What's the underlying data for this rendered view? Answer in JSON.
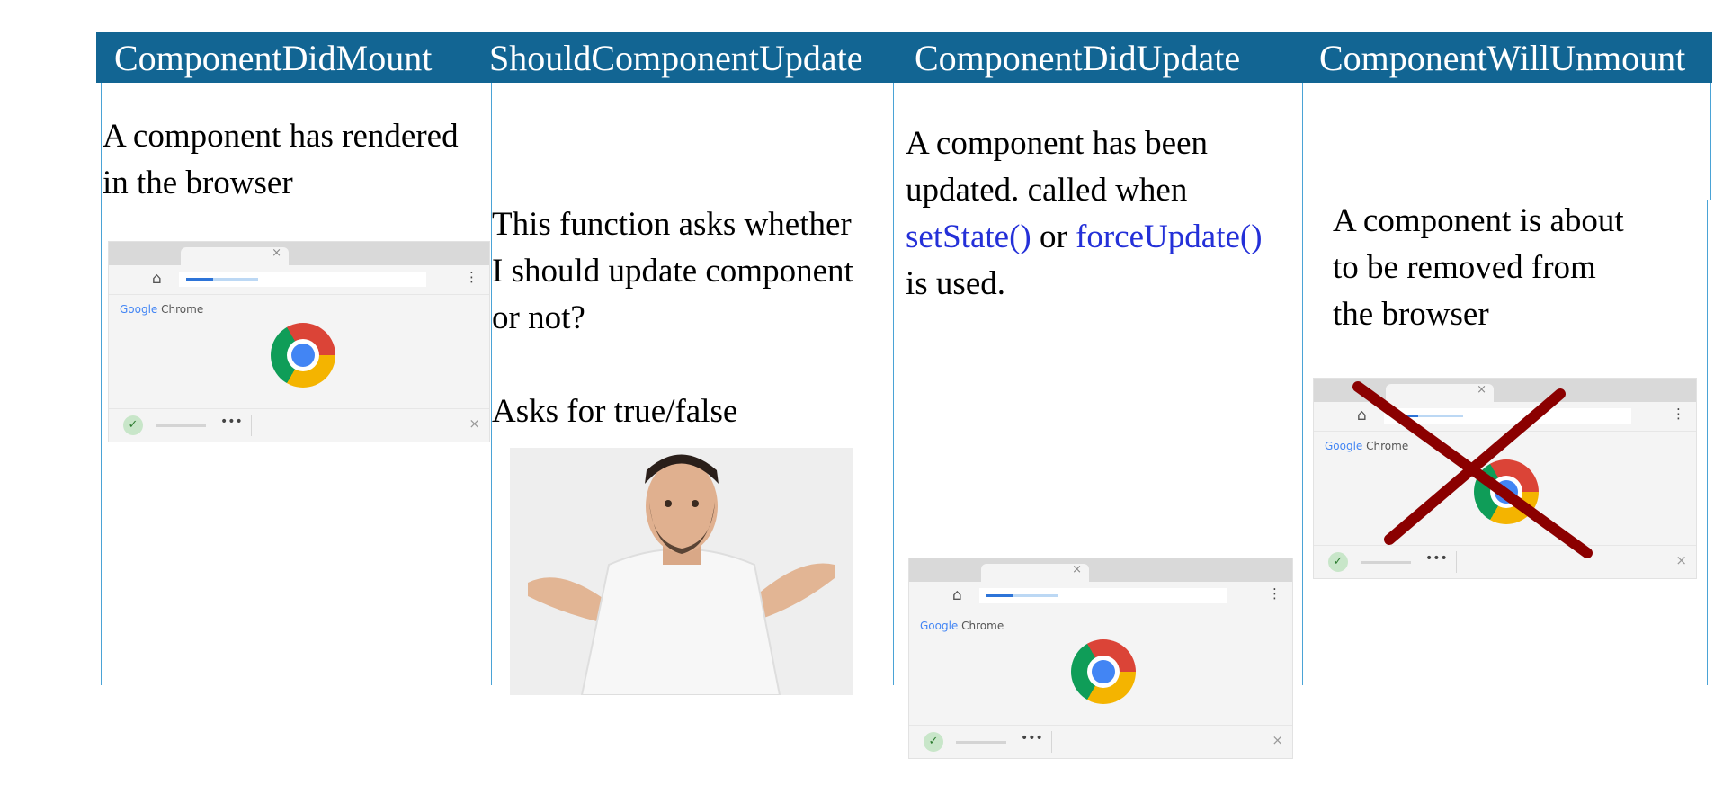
{
  "columns": [
    {
      "title": "ComponentDidMount",
      "lines": [
        "A component has rendered",
        "in the browser"
      ]
    },
    {
      "title": "ShouldComponentUpdate",
      "lines": [
        "This function asks whether",
        "I should update component",
        "or not?"
      ],
      "extra": "Asks for true/false"
    },
    {
      "title": "ComponentDidUpdate",
      "line1": "A component has been",
      "line2": "updated. called when",
      "fn1": "setState()",
      "or": " or ",
      "fn2": "forceUpdate()",
      "line4": "is used."
    },
    {
      "title": "ComponentWillUnmount",
      "lines": [
        "A component is about",
        "to be removed from",
        "the browser"
      ]
    }
  ],
  "browser": {
    "brand_google": "Google",
    "brand_chrome": "Chrome",
    "tab_close": "×",
    "menu": "⋮",
    "home": "⌂",
    "dots": "•••",
    "close": "×",
    "check": "✓"
  },
  "colors": {
    "header": "#126593",
    "function_text": "#2430d8",
    "cross": "#8b0000"
  },
  "icons": [
    "chrome-logo-icon",
    "home-icon",
    "menu-icon",
    "check-icon",
    "close-icon",
    "cross-icon"
  ]
}
